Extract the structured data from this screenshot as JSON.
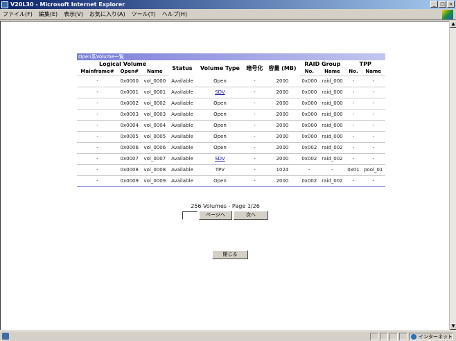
{
  "window": {
    "title": "V20L30 - Microsoft Internet Explorer",
    "buttons": [
      "_",
      "□",
      "×"
    ]
  },
  "menubar": {
    "items": [
      "ファイル(F)",
      "編集(E)",
      "表示(V)",
      "お気に入り(A)",
      "ツール(T)",
      "ヘルプ(H)"
    ]
  },
  "panel": {
    "header": "Open系Volume一覧",
    "columns": {
      "logical_volume": "Logical Volume",
      "mainframe": "Mainframe#",
      "open": "Open#",
      "name": "Name",
      "status": "Status",
      "volume_type": "Volume Type",
      "encryption": "暗号化",
      "capacity": "容量 (MB)",
      "raid_group": "RAID Group",
      "raid_no": "No.",
      "raid_name": "Name",
      "tpp": "TPP",
      "tpp_no": "No.",
      "tpp_name": "Name"
    },
    "rows": [
      {
        "mainframe": "-",
        "open": "0x0000",
        "name": "vol_0000",
        "status": "Available",
        "type": "Open",
        "link": false,
        "enc": "-",
        "cap": "2000",
        "raid_no": "0x000",
        "raid_name": "raid_000",
        "tpp_no": "-",
        "tpp_name": "-"
      },
      {
        "mainframe": "-",
        "open": "0x0001",
        "name": "vol_0001",
        "status": "Available",
        "type": "SDV",
        "link": true,
        "enc": "-",
        "cap": "2000",
        "raid_no": "0x000",
        "raid_name": "raid_000",
        "tpp_no": "-",
        "tpp_name": "-"
      },
      {
        "mainframe": "-",
        "open": "0x0002",
        "name": "vol_0002",
        "status": "Available",
        "type": "Open",
        "link": false,
        "enc": "-",
        "cap": "2000",
        "raid_no": "0x000",
        "raid_name": "raid_000",
        "tpp_no": "-",
        "tpp_name": "-"
      },
      {
        "mainframe": "-",
        "open": "0x0003",
        "name": "vol_0003",
        "status": "Available",
        "type": "Open",
        "link": false,
        "enc": "-",
        "cap": "2000",
        "raid_no": "0x000",
        "raid_name": "raid_000",
        "tpp_no": "-",
        "tpp_name": "-"
      },
      {
        "mainframe": "-",
        "open": "0x0004",
        "name": "vol_0004",
        "status": "Available",
        "type": "Open",
        "link": false,
        "enc": "-",
        "cap": "2000",
        "raid_no": "0x000",
        "raid_name": "raid_000",
        "tpp_no": "-",
        "tpp_name": "-"
      },
      {
        "mainframe": "-",
        "open": "0x0005",
        "name": "vol_0005",
        "status": "Available",
        "type": "Open",
        "link": false,
        "enc": "-",
        "cap": "2000",
        "raid_no": "0x000",
        "raid_name": "raid_000",
        "tpp_no": "-",
        "tpp_name": "-"
      },
      {
        "mainframe": "-",
        "open": "0x0006",
        "name": "vol_0006",
        "status": "Available",
        "type": "Open",
        "link": false,
        "enc": "-",
        "cap": "2000",
        "raid_no": "0x002",
        "raid_name": "raid_002",
        "tpp_no": "-",
        "tpp_name": "-"
      },
      {
        "mainframe": "-",
        "open": "0x0007",
        "name": "vol_0007",
        "status": "Available",
        "type": "SDV",
        "link": true,
        "enc": "-",
        "cap": "2000",
        "raid_no": "0x002",
        "raid_name": "raid_002",
        "tpp_no": "-",
        "tpp_name": "-"
      },
      {
        "mainframe": "-",
        "open": "0x0008",
        "name": "vol_0008",
        "status": "Available",
        "type": "TPV",
        "link": false,
        "enc": "-",
        "cap": "1024",
        "raid_no": "-",
        "raid_name": "-",
        "tpp_no": "0x01",
        "tpp_name": "pool_01"
      },
      {
        "mainframe": "-",
        "open": "0x0009",
        "name": "vol_0009",
        "status": "Available",
        "type": "Open",
        "link": false,
        "enc": "-",
        "cap": "2000",
        "raid_no": "0x002",
        "raid_name": "raid_002",
        "tpp_no": "-",
        "tpp_name": "-"
      }
    ]
  },
  "pager": {
    "summary": "256 Volumes - Page 1/26",
    "page_input_value": "",
    "goto_label": "ページへ",
    "next_label": "次へ"
  },
  "close_label": "閉じる",
  "statusbar": {
    "zone": "インターネット"
  },
  "colors": {
    "panel_header_start": "#7b7fd6",
    "panel_header_end": "#c3c5f0",
    "link": "#1a1aa0",
    "titlebar_start": "#0a246a"
  }
}
